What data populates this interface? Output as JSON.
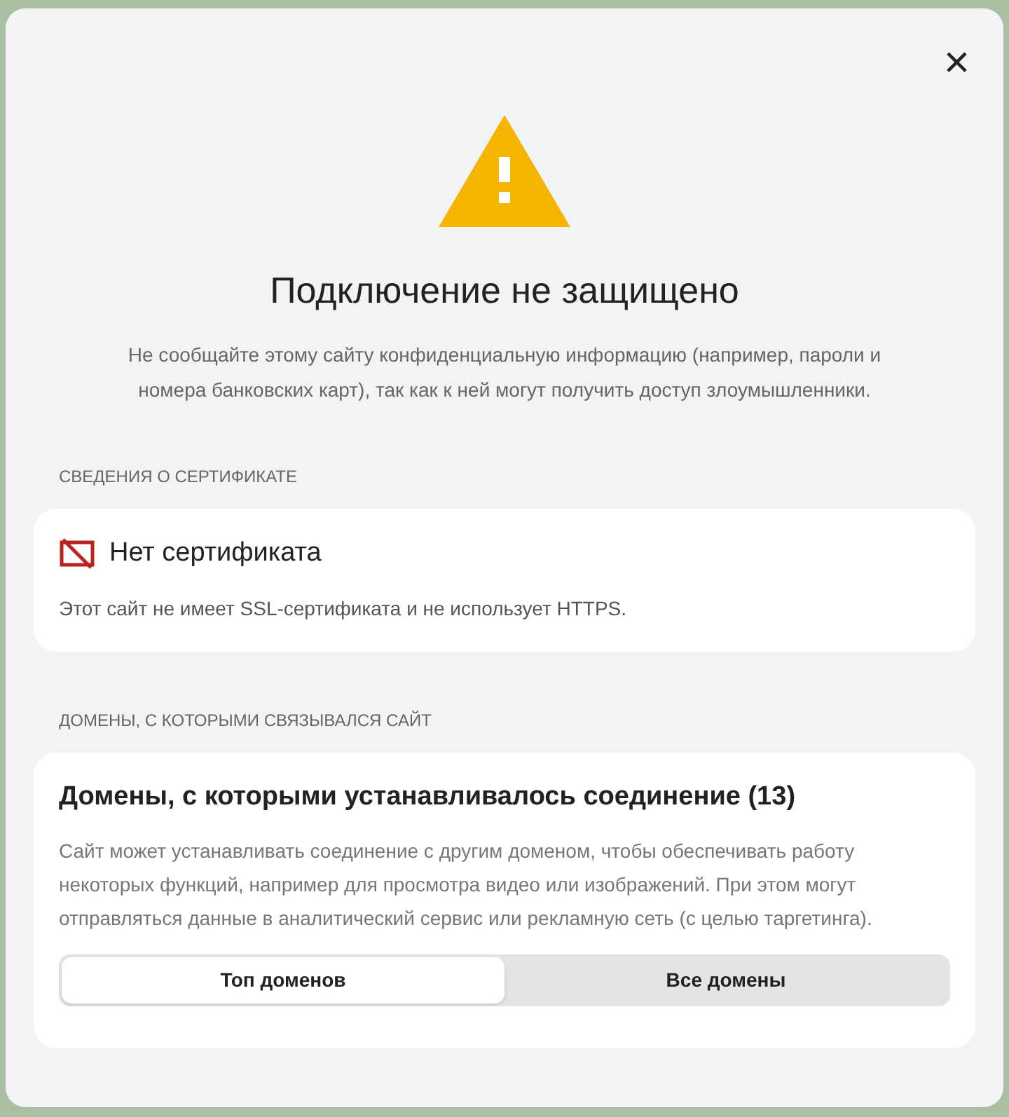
{
  "dialog": {
    "title": "Подключение не защищено",
    "description": "Не сообщайте этому сайту конфиденциальную информацию (например, пароли и номера банковских карт), так как к ней могут получить доступ злоумышленники.",
    "close": "×"
  },
  "certificate_section": {
    "label": "СВЕДЕНИЯ О СЕРТИФИКАТЕ",
    "card": {
      "title": "Нет сертификата",
      "text": "Этот сайт не имеет SSL-сертификата и не использует HTTPS."
    }
  },
  "domains_section": {
    "label": "ДОМЕНЫ, С КОТОРЫМИ СВЯЗЫВАЛСЯ САЙТ",
    "card": {
      "title": "Домены, с которыми устанавливалось соединение (13)",
      "text": "Сайт может устанавливать соединение с другим доменом, чтобы обеспечивать работу некоторых функций, например для просмотра видео или изображений. При этом могут отправляться данные в аналитический сервис или рекламную сеть (с целью таргетинга).",
      "tabs": [
        {
          "label": "Топ доменов",
          "selected": true
        },
        {
          "label": "Все домены",
          "selected": false
        }
      ]
    }
  }
}
